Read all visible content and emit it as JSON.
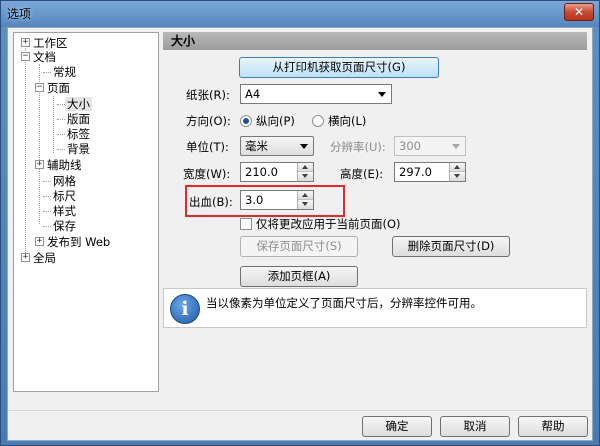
{
  "window": {
    "title": "选项",
    "close_glyph": "✕"
  },
  "tree": {
    "items": [
      {
        "label": "工作区",
        "expander": "+"
      },
      {
        "label": "文档",
        "expander": "−"
      },
      {
        "label": "常规"
      },
      {
        "label": "页面",
        "expander": "−"
      },
      {
        "label": "大小"
      },
      {
        "label": "版面"
      },
      {
        "label": "标签"
      },
      {
        "label": "背景"
      },
      {
        "label": "辅助线",
        "expander": "+"
      },
      {
        "label": "网格"
      },
      {
        "label": "标尺"
      },
      {
        "label": "样式"
      },
      {
        "label": "保存"
      },
      {
        "label": "发布到 Web",
        "expander": "+"
      },
      {
        "label": "全局",
        "expander": "+"
      }
    ]
  },
  "panel": {
    "header": "大小",
    "get_from_printer_button": "从打印机获取页面尺寸(G)",
    "paper_label": "纸张(R):",
    "paper_value": "A4",
    "orientation_label": "方向(O):",
    "portrait_label": "纵向(P)",
    "landscape_label": "横向(L)",
    "orientation_selected": "纵向(P)",
    "unit_label": "单位(T):",
    "unit_value": "毫米",
    "resolution_label": "分辨率(U):",
    "resolution_value": "300",
    "width_label": "宽度(W):",
    "width_value": "210.0",
    "height_label": "高度(E):",
    "height_value": "297.0",
    "bleed_label": "出血(B):",
    "bleed_value": "3.0",
    "apply_current_only_label": "仅将更改应用于当前页面(O)",
    "apply_current_only_checked": false,
    "save_page_size_button": "保存页面尺寸(S)",
    "delete_page_size_button": "删除页面尺寸(D)",
    "add_page_frame_button": "添加页框(A)",
    "info_icon_glyph": "i",
    "info_text": "当以像素为单位定义了页面尺寸后，分辨率控件可用。"
  },
  "footer": {
    "ok_button": "确定",
    "cancel_button": "取消",
    "help_button": "帮助"
  },
  "colors": {
    "highlight_border": "#e12b2b",
    "title_bar": "#5586be",
    "radio_dot": "#1b4fa0"
  }
}
